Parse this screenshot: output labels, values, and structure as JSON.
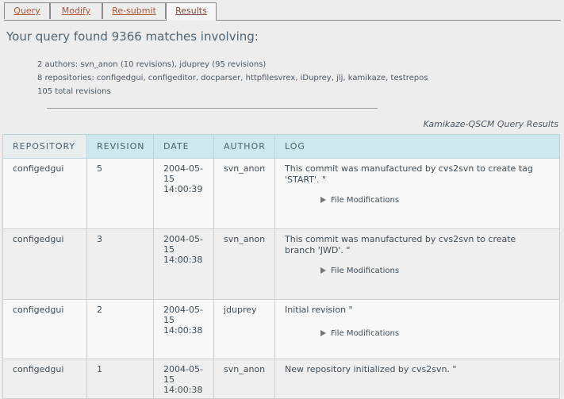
{
  "tabs": [
    {
      "label": "Query"
    },
    {
      "label": "Modify"
    },
    {
      "label": "Re-submit"
    },
    {
      "label": "Results"
    }
  ],
  "headline": "Your query found 9366 matches involving:",
  "summary": {
    "authors": "2 authors: svn_anon (10 revisions), jduprey (95 revisions)",
    "repositories": "8 repositories: configedgui, configeditor, docparser, httpfilesvrex, iDuprey, jlj, kamikaze, testrepos",
    "total": "105 total revisions"
  },
  "caption": "Kamikaze-QSCM Query Results",
  "table": {
    "headers": [
      "REPOSITORY",
      "REVISION",
      "DATE",
      "AUTHOR",
      "LOG"
    ],
    "file_mod_label": "File Modifications",
    "rows": [
      {
        "repository": "configedgui",
        "revision": "5",
        "date": "2004-05-15",
        "time": "14:00:39",
        "author": "svn_anon",
        "log": "This commit was manufactured by cvs2svn to create tag 'START'. \""
      },
      {
        "repository": "configedgui",
        "revision": "3",
        "date": "2004-05-15",
        "time": "14:00:38",
        "author": "svn_anon",
        "log": "This commit was manufactured by cvs2svn to create branch 'JWD'. \""
      },
      {
        "repository": "configedgui",
        "revision": "2",
        "date": "2004-05-15",
        "time": "14:00:38",
        "author": "jduprey",
        "log": "Initial revision \""
      },
      {
        "repository": "configedgui",
        "revision": "1",
        "date": "2004-05-15",
        "time": "14:00:38",
        "author": "svn_anon",
        "log": "New repository initialized by cvs2svn. \""
      }
    ]
  }
}
